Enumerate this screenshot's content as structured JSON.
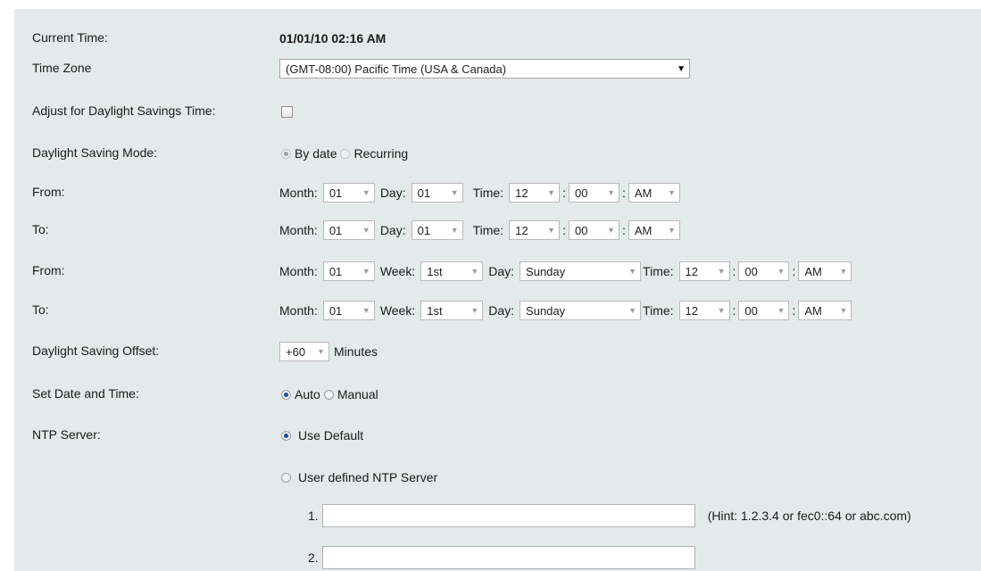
{
  "rows": {
    "current_time": {
      "label": "Current Time:",
      "value": "01/01/10 02:16 AM"
    },
    "time_zone": {
      "label": "Time Zone",
      "value": "(GMT-08:00) Pacific Time (USA & Canada)"
    },
    "dst_adjust": {
      "label": "Adjust for Daylight Savings Time:",
      "checked": false
    },
    "dst_mode": {
      "label": "Daylight Saving Mode:",
      "option1": "By date",
      "option2": "Recurring",
      "selected": "By date"
    },
    "from_date": {
      "label": "From:",
      "month_label": "Month:",
      "month": "01",
      "day_label": "Day:",
      "day": "01",
      "time_label": "Time:",
      "hour": "12",
      "minute": "00",
      "ampm": "AM"
    },
    "to_date": {
      "label": "To:",
      "month_label": "Month:",
      "month": "01",
      "day_label": "Day:",
      "day": "01",
      "time_label": "Time:",
      "hour": "12",
      "minute": "00",
      "ampm": "AM"
    },
    "from_recur": {
      "label": "From:",
      "month_label": "Month:",
      "month": "01",
      "week_label": "Week:",
      "week": "1st",
      "day_label": "Day:",
      "day": "Sunday",
      "time_label": "Time:",
      "hour": "12",
      "minute": "00",
      "ampm": "AM"
    },
    "to_recur": {
      "label": "To:",
      "month_label": "Month:",
      "month": "01",
      "week_label": "Week:",
      "week": "1st",
      "day_label": "Day:",
      "day": "Sunday",
      "time_label": "Time:",
      "hour": "12",
      "minute": "00",
      "ampm": "AM"
    },
    "dst_offset": {
      "label": "Daylight Saving Offset:",
      "value": "+60",
      "unit": "Minutes"
    },
    "set_datetime": {
      "label": "Set Date and Time:",
      "option1": "Auto",
      "option2": "Manual",
      "selected": "Auto"
    },
    "ntp": {
      "label": "NTP Server:",
      "option1": "Use Default",
      "option2": "User defined NTP Server",
      "selected": "Use Default"
    },
    "ntp_fields": {
      "field1_label": "1.",
      "field1_value": "",
      "hint": "(Hint: 1.2.3.4 or fec0::64 or abc.com)",
      "field2_label": "2.",
      "field2_value": ""
    }
  },
  "colors": {
    "panel_bg": "#e3ebea",
    "radio_selected": "#1f4f8f"
  },
  "icons": {
    "dropdown": "chevron-down-icon"
  }
}
